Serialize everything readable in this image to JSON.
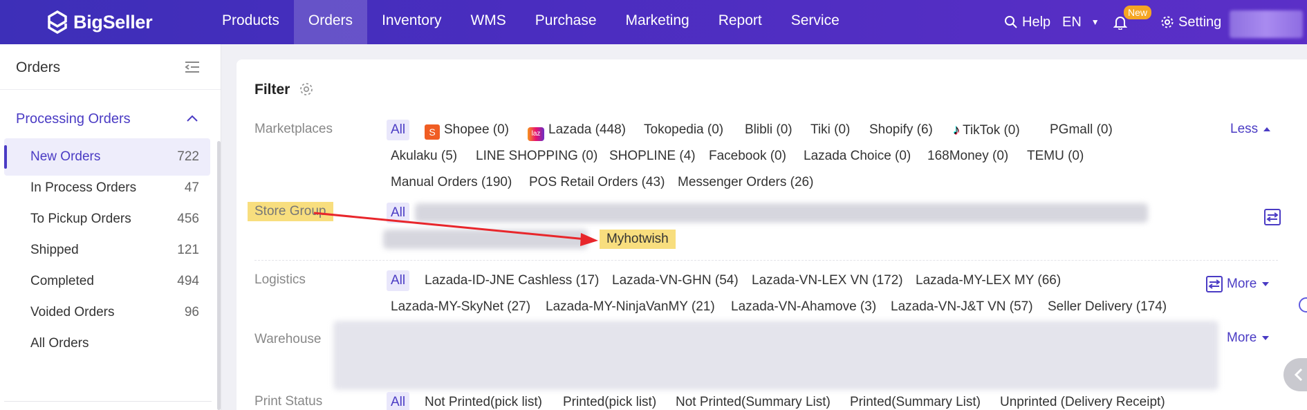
{
  "brand": {
    "name": "BigSeller"
  },
  "nav": {
    "items": [
      {
        "label": "Products",
        "active": false
      },
      {
        "label": "Orders",
        "active": true
      },
      {
        "label": "Inventory",
        "active": false
      },
      {
        "label": "WMS",
        "active": false
      },
      {
        "label": "Purchase",
        "active": false
      },
      {
        "label": "Marketing",
        "active": false
      },
      {
        "label": "Report",
        "active": false
      },
      {
        "label": "Service",
        "active": false
      }
    ],
    "help": "Help",
    "language": "EN",
    "new_badge": "New",
    "setting": "Setting"
  },
  "sidebar": {
    "title": "Orders",
    "section": "Processing Orders",
    "items": [
      {
        "label": "New Orders",
        "count": "722",
        "active": true
      },
      {
        "label": "In Process Orders",
        "count": "47"
      },
      {
        "label": "To Pickup Orders",
        "count": "456"
      },
      {
        "label": "Shipped",
        "count": "121"
      },
      {
        "label": "Completed",
        "count": "494"
      },
      {
        "label": "Voided Orders",
        "count": "96"
      },
      {
        "label": "All Orders",
        "count": ""
      }
    ]
  },
  "filter": {
    "title": "Filter",
    "all": "All",
    "marketplaces_label": "Marketplaces",
    "less": "Less",
    "more": "More",
    "marketplaces": [
      "Shopee (0)",
      "Lazada (448)",
      "Tokopedia (0)",
      "Blibli (0)",
      "Tiki (0)",
      "Shopify (6)",
      "TikTok (0)",
      "PGmall (0)",
      "Akulaku (5)",
      "LINE SHOPPING (0)",
      "SHOPLINE (4)",
      "Facebook (0)",
      "Lazada Choice (0)",
      "168Money (0)",
      "TEMU (0)",
      "Manual Orders (190)",
      "POS Retail Orders (43)",
      "Messenger Orders (26)"
    ],
    "store_group_label": "Store Group",
    "store_highlight": "Myhotwish",
    "logistics_label": "Logistics",
    "logistics": [
      "Lazada-ID-JNE Cashless (17)",
      "Lazada-VN-GHN (54)",
      "Lazada-VN-LEX VN (172)",
      "Lazada-MY-LEX MY (66)",
      "Lazada-MY-SkyNet (27)",
      "Lazada-MY-NinjaVanMY (21)",
      "Lazada-VN-Ahamove (3)",
      "Lazada-VN-J&T VN (57)",
      "Seller Delivery (174)"
    ],
    "warehouse_label": "Warehouse",
    "print_status_label": "Print Status",
    "print_status": [
      "Not Printed(pick list)",
      "Printed(pick list)",
      "Not Printed(Summary List)",
      "Printed(Summary List)",
      "Unprinted (Delivery Receipt)"
    ]
  },
  "colors": {
    "accent": "#4a3bc4",
    "highlight": "#f8de7e",
    "arrow": "#e8262b"
  }
}
